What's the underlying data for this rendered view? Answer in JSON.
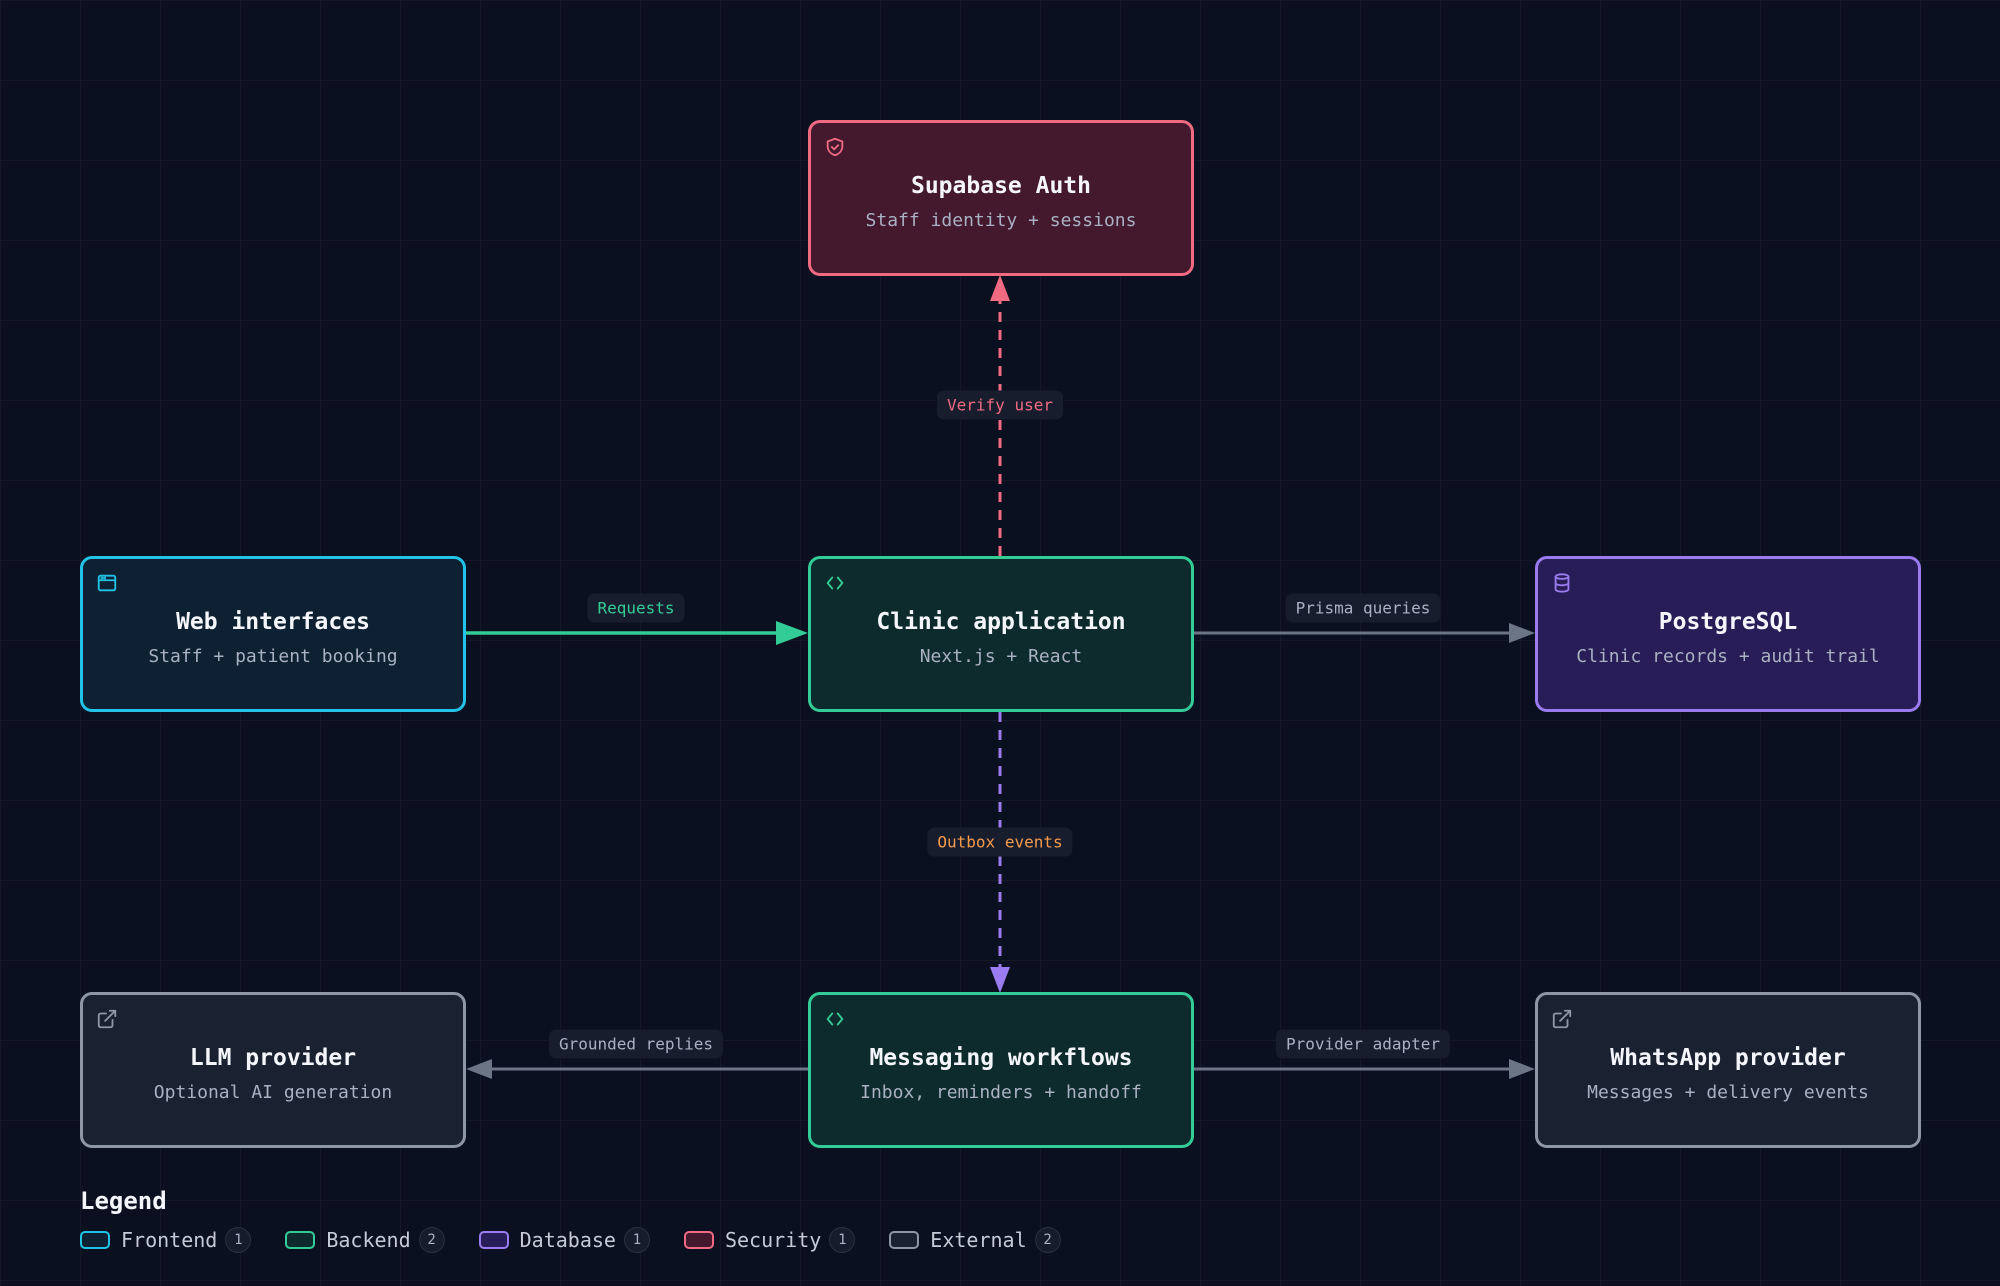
{
  "nodes": {
    "supabase_auth": {
      "title": "Supabase Auth",
      "subtitle": "Staff identity + sessions",
      "icon": "shield-icon"
    },
    "web_interfaces": {
      "title": "Web interfaces",
      "subtitle": "Staff + patient booking",
      "icon": "browser-window-icon"
    },
    "clinic_application": {
      "title": "Clinic application",
      "subtitle": "Next.js + React",
      "icon": "code-icon"
    },
    "postgresql": {
      "title": "PostgreSQL",
      "subtitle": "Clinic records + audit trail",
      "icon": "database-icon"
    },
    "llm_provider": {
      "title": "LLM provider",
      "subtitle": "Optional AI generation",
      "icon": "external-link-icon"
    },
    "messaging_workflows": {
      "title": "Messaging workflows",
      "subtitle": "Inbox, reminders + handoff",
      "icon": "code-icon"
    },
    "whatsapp_provider": {
      "title": "WhatsApp provider",
      "subtitle": "Messages + delivery events",
      "icon": "external-link-icon"
    }
  },
  "edges": {
    "verify_user": {
      "label": "Verify user",
      "color": "#f06a82"
    },
    "requests": {
      "label": "Requests",
      "color": "#33cc96"
    },
    "prisma_queries": {
      "label": "Prisma queries",
      "color": "#a9b1c3"
    },
    "outbox_events": {
      "label": "Outbox events",
      "color": "#f59a4a"
    },
    "grounded_replies": {
      "label": "Grounded replies",
      "color": "#a9b1c3"
    },
    "provider_adapter": {
      "label": "Provider adapter",
      "color": "#a9b1c3"
    }
  },
  "legend": {
    "title": "Legend",
    "items": [
      {
        "label": "Frontend",
        "count": "1",
        "color": "#22c3e6"
      },
      {
        "label": "Backend",
        "count": "2",
        "color": "#33cc96"
      },
      {
        "label": "Database",
        "count": "1",
        "color": "#9a7cf0"
      },
      {
        "label": "Security",
        "count": "1",
        "color": "#f06a82"
      },
      {
        "label": "External",
        "count": "2",
        "color": "#8e97a6"
      }
    ]
  }
}
